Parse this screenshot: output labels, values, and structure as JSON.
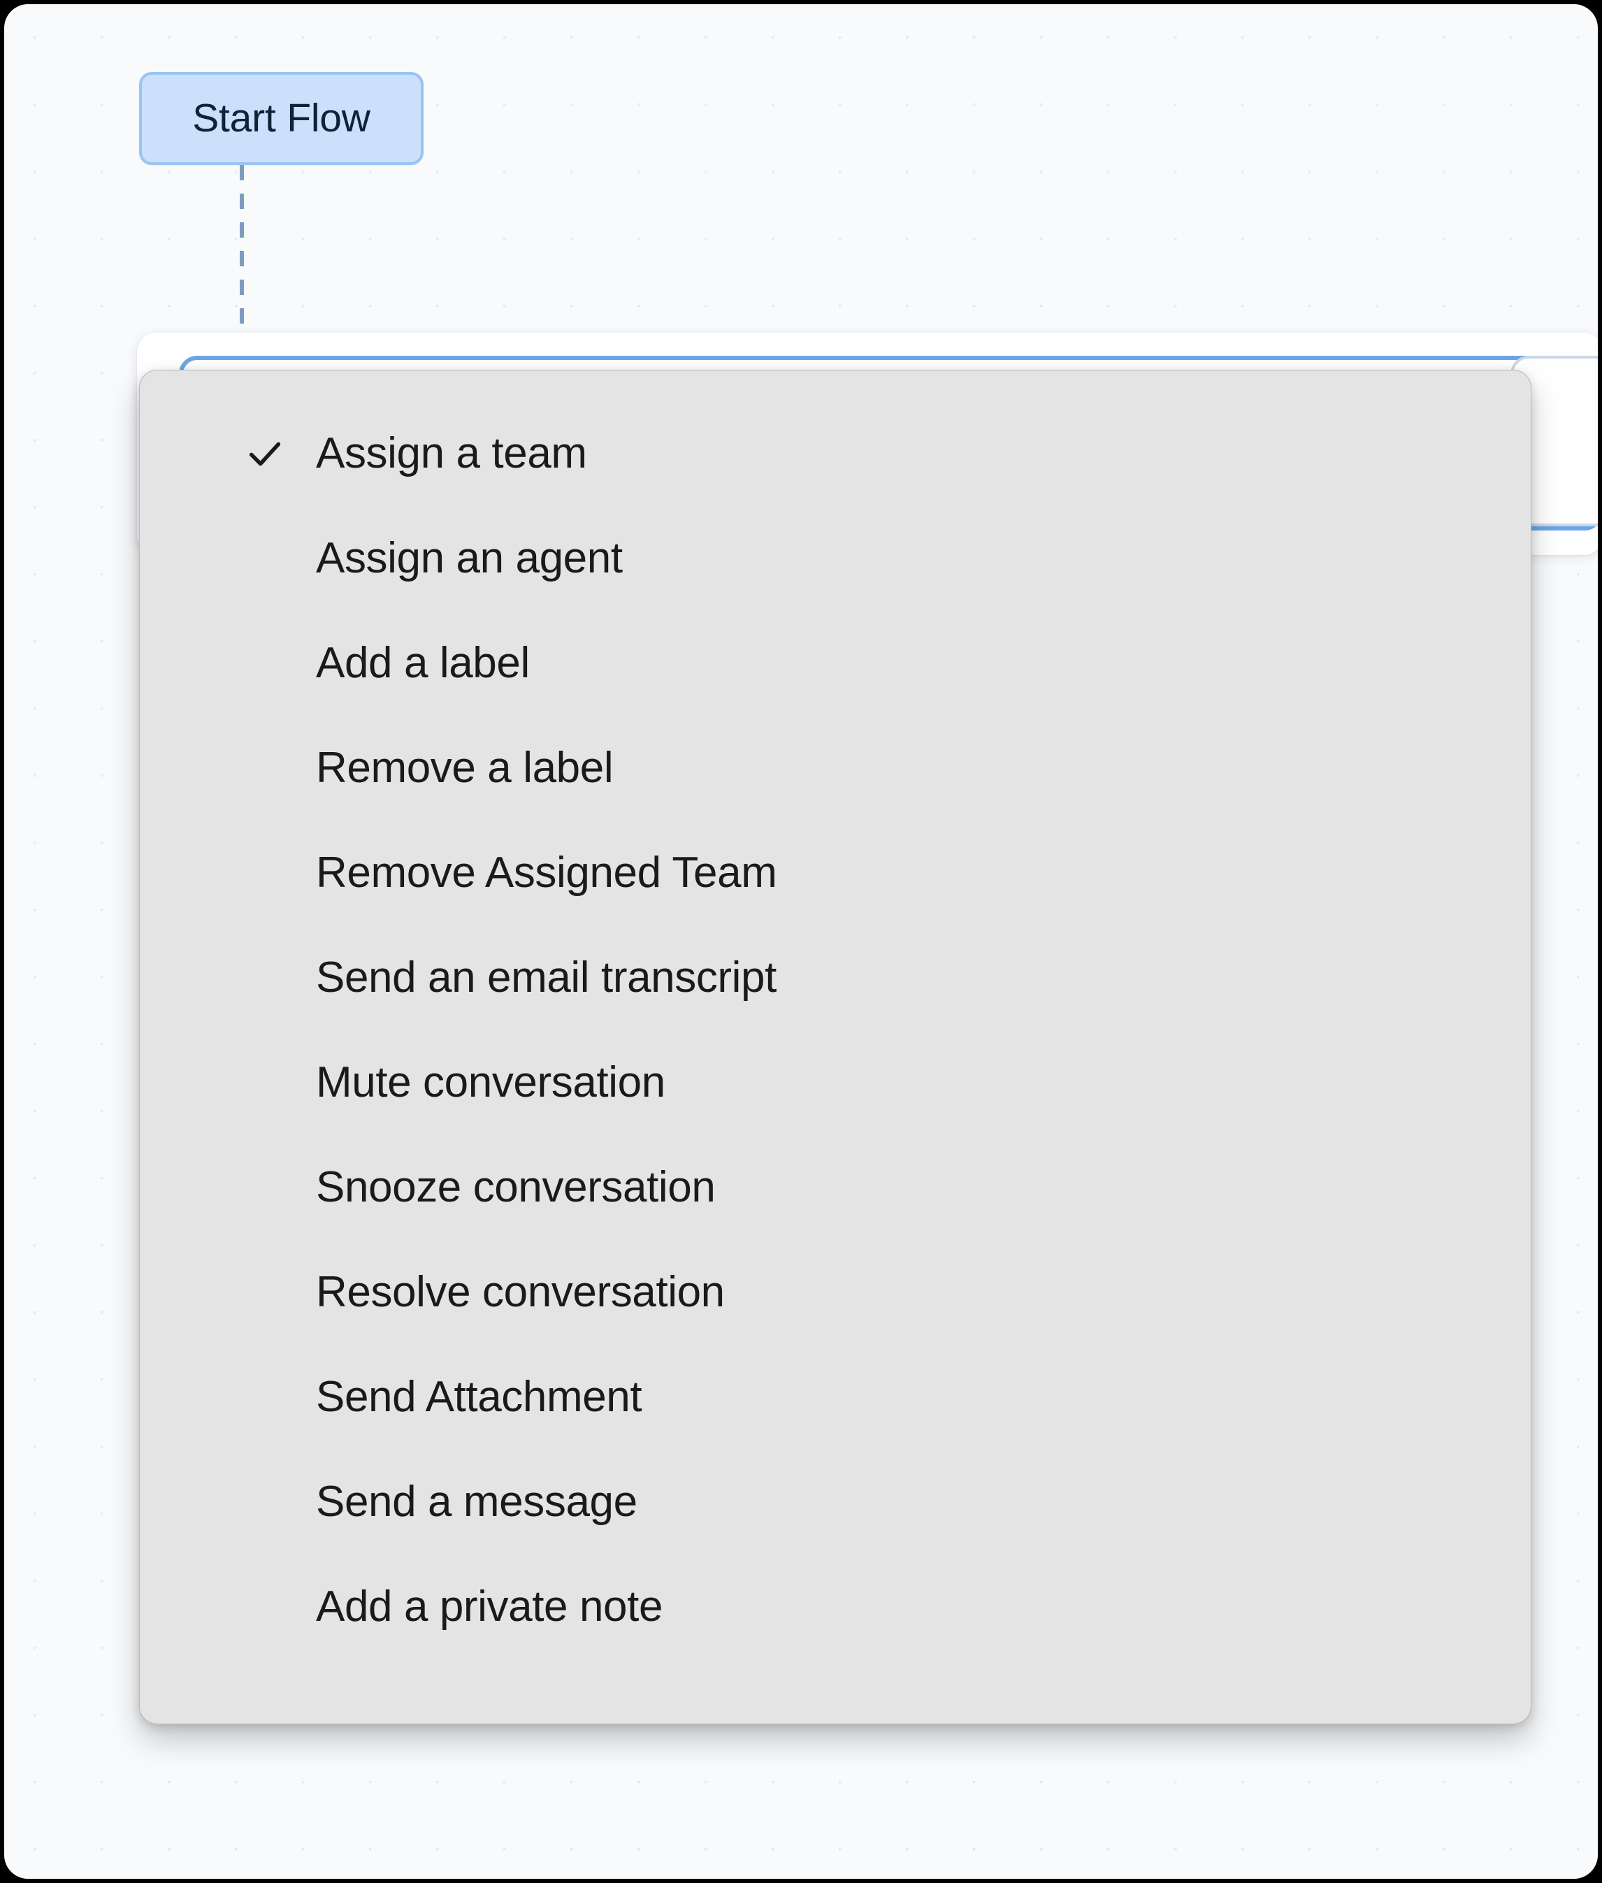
{
  "canvas": {
    "background_color": "#F8FAFC",
    "grid_dot_color": "#E6EAF0"
  },
  "nodes": {
    "start": {
      "label": "Start Flow",
      "fill_color": "#CBE0FA",
      "border_color": "#9AC4F2",
      "text_color": "#0F2236"
    }
  },
  "connector": {
    "style": "dashed",
    "color": "#7E9CBF"
  },
  "action_card": {
    "select": {
      "value": "",
      "placeholder": "",
      "focus_border_color": "#6CA5E8",
      "state": "focused-open"
    }
  },
  "dropdown": {
    "name": "action-select-menu",
    "background_color": "#E4E4E4",
    "text_color": "#1A1A1A",
    "selected_index": 0,
    "check_icon": "checkmark-icon",
    "items": [
      {
        "label": "Assign a team",
        "selected": true
      },
      {
        "label": "Assign an agent",
        "selected": false
      },
      {
        "label": "Add a label",
        "selected": false
      },
      {
        "label": "Remove a label",
        "selected": false
      },
      {
        "label": "Remove Assigned Team",
        "selected": false
      },
      {
        "label": "Send an email transcript",
        "selected": false
      },
      {
        "label": "Mute conversation",
        "selected": false
      },
      {
        "label": "Snooze conversation",
        "selected": false
      },
      {
        "label": "Resolve conversation",
        "selected": false
      },
      {
        "label": "Send Attachment",
        "selected": false
      },
      {
        "label": "Send a message",
        "selected": false
      },
      {
        "label": "Add a private note",
        "selected": false
      }
    ]
  }
}
